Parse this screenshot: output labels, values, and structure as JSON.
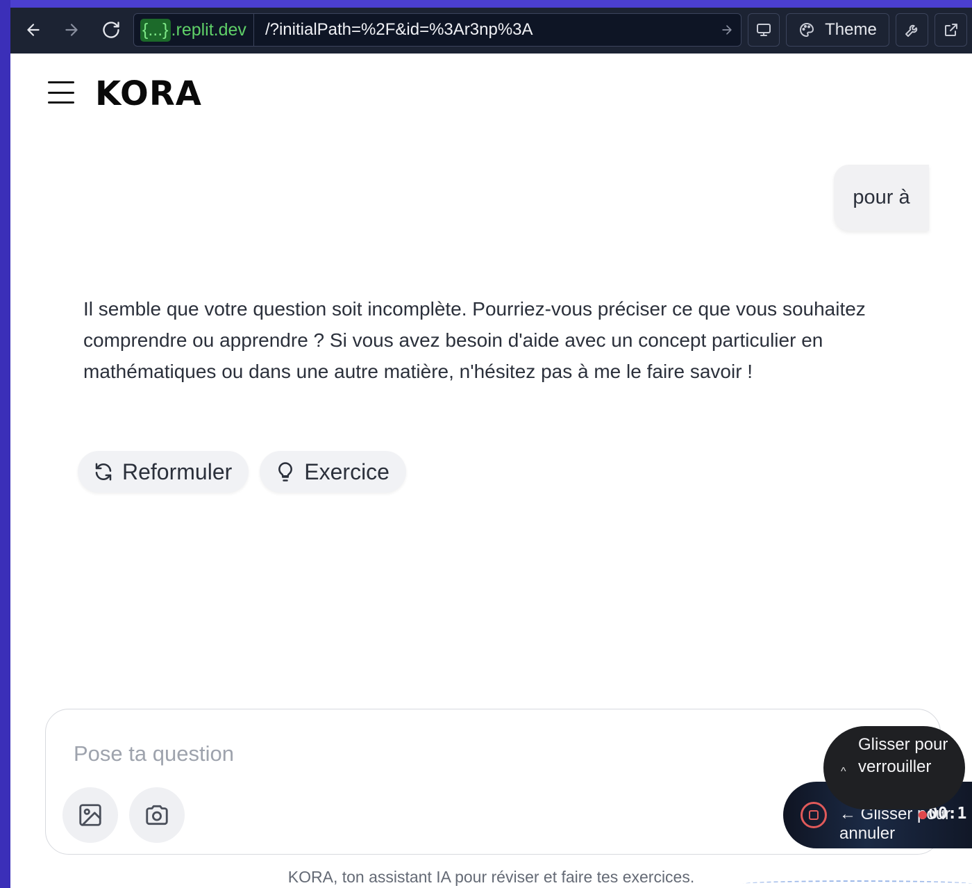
{
  "browser": {
    "domain_chip": "{...}",
    "domain": ".replit.dev",
    "path": "/?initialPath=%2F&id=%3Ar3np%3A",
    "theme_label": "Theme"
  },
  "app": {
    "title": "KORA",
    "user_message": "pour à",
    "assistant_message": "Il semble que votre question soit incomplète. Pourriez-vous préciser ce que vous souhaitez comprendre ou apprendre ? Si vous avez besoin d'aide avec un concept particulier en mathématiques ou dans une autre matière, n'hésitez pas à me le faire savoir !",
    "actions": {
      "rephrase_label": "Reformuler",
      "exercise_label": "Exercice"
    },
    "composer": {
      "placeholder": "Pose ta question"
    },
    "recording": {
      "lock_hint": "Glisser pour verrouiller",
      "caret": "^",
      "slide_hint": "← Glisser pour annuler",
      "timer": "00:1"
    },
    "footer": "KORA, ton assistant IA pour réviser et faire tes exercices."
  },
  "colors": {
    "accent_frame": "#4338ca",
    "browser_bar": "#1c2333",
    "domain_green": "#5fd068",
    "record_red": "#e05a5a"
  }
}
